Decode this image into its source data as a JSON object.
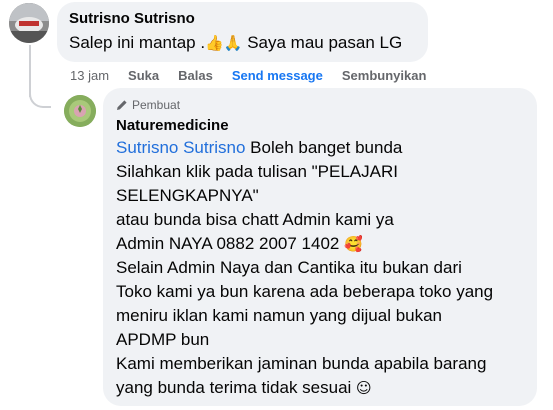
{
  "comment": {
    "author": "Sutrisno Sutrisno",
    "text_before": "Salep ini mantap .",
    "emoji_1": "👍",
    "emoji_2": "🙏",
    "text_after": " Saya mau pasan LG",
    "time": "13 jam",
    "actions": {
      "like": "Suka",
      "reply": "Balas",
      "send_message": "Send message",
      "hide": "Sembunyikan"
    }
  },
  "reply": {
    "badge": "Pembuat",
    "author": "Naturemedicine",
    "mention": "Sutrisno Sutrisno",
    "lines": [
      " Boleh banget bunda",
      "Silahkan klik pada tulisan \"PELAJARI",
      "SELENGKAPNYA\"",
      "atau bunda bisa chatt Admin kami ya",
      "Admin NAYA 0882 2007 1402 ",
      "Selain Admin Naya dan Cantika itu bukan dari",
      "Toko kami ya bun karena ada beberapa toko yang",
      "meniru iklan kami namun yang dijual bukan",
      "APDMP bun",
      "Kami memberikan jaminan bunda apabila barang",
      "yang bunda terima tidak sesuai "
    ],
    "emoji_love": "🥰",
    "emoji_smile": "☺"
  },
  "icons": {
    "user_avatar": "avatar-photo",
    "page_avatar": "naturemedicine-logo",
    "author_badge": "pencil-icon"
  },
  "colors": {
    "bubble": "#f0f2f5",
    "link": "#1877f2",
    "mention": "#216fdb",
    "meta": "#65676b"
  }
}
